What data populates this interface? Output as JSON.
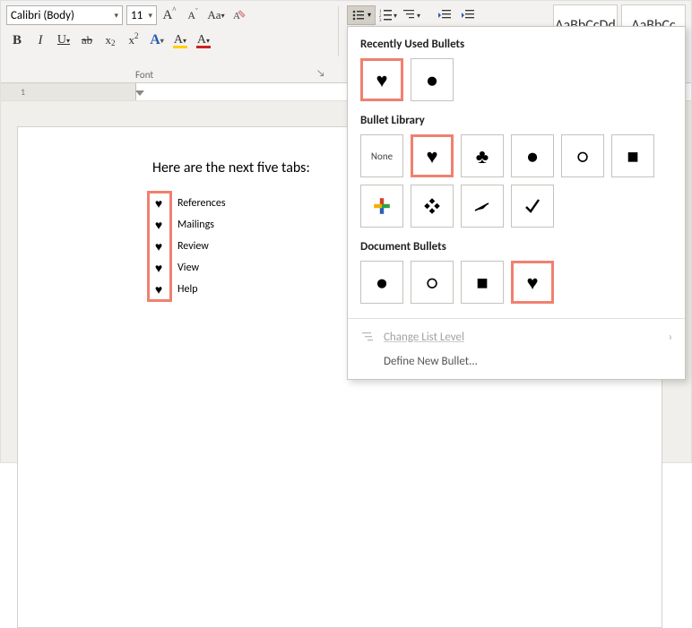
{
  "ribbon": {
    "font_name": "Calibri (Body)",
    "font_size": "11",
    "group_font_label": "Font",
    "styles": [
      "AaBbCcDd",
      "AaBbCc"
    ]
  },
  "document": {
    "intro": "Here are the next five tabs:",
    "items": [
      "References",
      "Mailings",
      "Review",
      "View",
      "Help"
    ],
    "bullet_glyph": "♥"
  },
  "dropdown": {
    "section_recent": "Recently Used Bullets",
    "section_library": "Bullet Library",
    "section_document": "Document Bullets",
    "none_label": "None",
    "change_level": "Change List Level",
    "define_new": "Define New Bullet..."
  }
}
